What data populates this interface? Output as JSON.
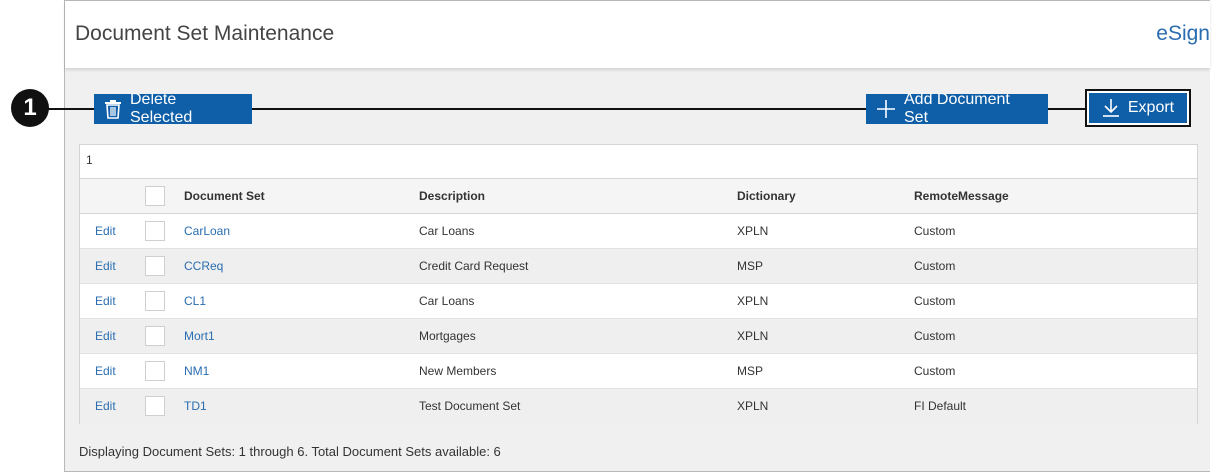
{
  "header": {
    "title": "Document Set Maintenance",
    "brand": "eSign"
  },
  "toolbar": {
    "delete_label": "Delete Selected",
    "add_label": "Add Document Set",
    "export_label": "Export",
    "delete_icon": "trash-icon",
    "add_icon": "plus-icon",
    "export_icon": "download-icon"
  },
  "callout": {
    "number": "1"
  },
  "grid": {
    "pager": "1",
    "columns": {
      "document_set": "Document Set",
      "description": "Description",
      "dictionary": "Dictionary",
      "remote_message": "RemoteMessage"
    },
    "rows": [
      {
        "action": "Edit",
        "document_set": "CarLoan",
        "description": "Car Loans",
        "dictionary": "XPLN",
        "remote_message": "Custom"
      },
      {
        "action": "Edit",
        "document_set": "CCReq",
        "description": "Credit Card Request",
        "dictionary": "MSP",
        "remote_message": "Custom"
      },
      {
        "action": "Edit",
        "document_set": "CL1",
        "description": "Car Loans",
        "dictionary": "XPLN",
        "remote_message": "Custom"
      },
      {
        "action": "Edit",
        "document_set": "Mort1",
        "description": "Mortgages",
        "dictionary": "XPLN",
        "remote_message": "Custom"
      },
      {
        "action": "Edit",
        "document_set": "NM1",
        "description": "New Members",
        "dictionary": "MSP",
        "remote_message": "Custom"
      },
      {
        "action": "Edit",
        "document_set": "TD1",
        "description": "Test Document Set",
        "dictionary": "XPLN",
        "remote_message": "FI Default"
      }
    ]
  },
  "footer": {
    "status": "Displaying Document Sets: 1 through 6. Total Document Sets available: 6"
  },
  "colors": {
    "button": "#0f5ea8",
    "link": "#2a6db0",
    "panel_bg": "#f0f0f0"
  }
}
